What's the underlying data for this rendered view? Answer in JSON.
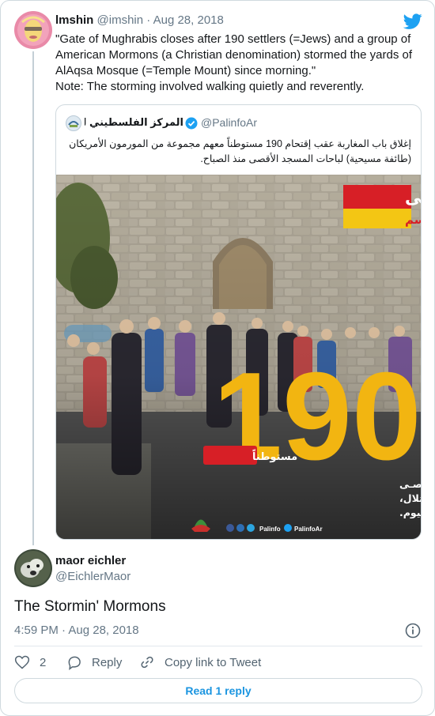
{
  "tweet": {
    "author_name": "lmshin",
    "author_handle": "@imshin",
    "separator": "·",
    "date": "Aug 28, 2018",
    "text_lines": [
      "\"Gate of Mughrabis closes after 190 settlers (=Jews) and a group of",
      "American Mormons (a Christian denomination) stormed the yards of",
      "AlAqsa Mosque (=Temple Mount) since morning.\"",
      "Note: The storming involved walking quietly and reverently."
    ]
  },
  "quoted_tweet": {
    "name": "المركز الفلسطيني للإعلام",
    "handle": "@PalinfoAr",
    "text_lines": [
      "إغلاق باب المغاربة عقب إقتحام 190 مستوطناً معهم مجموعة من المورمون الأمريكان",
      "(طائفة مسيحية) لباحات المسجد الأقصى منذ الصباح."
    ],
    "image": {
      "badge_line1": "الأقصى",
      "badge_line2": "#لن_يقسم",
      "big_number": "190",
      "settlers_label": "مستوطناً",
      "caption_lines": [
        "اقتحموا باحات المسـجد الأقصـى",
        "المبارك بحماية من قوات الاحتلال،",
        "صباح اليوم."
      ],
      "social_label_1": "Palinfo",
      "social_label_2": "PalinfoAr"
    }
  },
  "reply": {
    "author_name": "maor eichler",
    "author_handle": "@EichlerMaor",
    "text": "The Stormin' Mormons",
    "timestamp": "4:59 PM · Aug 28, 2018"
  },
  "actions": {
    "like_count": "2",
    "reply_label": "Reply",
    "copy_link_label": "Copy link to Tweet",
    "read_replies_label": "Read 1 reply"
  },
  "colors": {
    "twitter_blue": "#1da1f2",
    "link_blue": "#1b95e0",
    "muted_text": "#657786",
    "badge_red": "#d71f26",
    "badge_yellow": "#f3c614",
    "number_yellow": "#f2b511"
  }
}
